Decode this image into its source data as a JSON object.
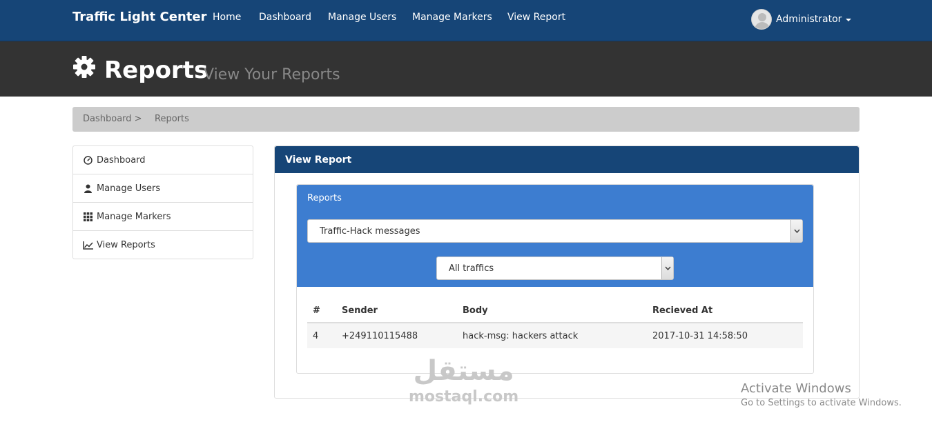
{
  "navbar": {
    "brand": "Traffic Light Center",
    "links": [
      "Home",
      "Dashboard",
      "Manage Users",
      "Manage Markers",
      "View Report"
    ],
    "user": "Administrator"
  },
  "header": {
    "title": "Reports",
    "subtitle": "View Your Reports"
  },
  "breadcrumb": {
    "items": [
      "Dashboard >",
      "Reports"
    ]
  },
  "sidebar": {
    "items": [
      {
        "label": "Dashboard",
        "icon": "dashboard-icon"
      },
      {
        "label": "Manage Users",
        "icon": "user-icon"
      },
      {
        "label": "Manage Markers",
        "icon": "grid-icon"
      },
      {
        "label": "View Reports",
        "icon": "line-chart-icon"
      }
    ]
  },
  "panel": {
    "heading": "View Report",
    "inner_label": "Reports",
    "report_select": "Traffic-Hack messages",
    "traffic_select": "All traffics",
    "table": {
      "headers": [
        "#",
        "Sender",
        "Body",
        "Recieved At"
      ],
      "rows": [
        [
          "4",
          "+249110115488",
          "hack-msg: hackers attack",
          "2017-10-31 14:58:50"
        ]
      ]
    }
  },
  "watermark": {
    "arabic": "مستقل",
    "latin": "mostaql.com"
  },
  "windows_notice": {
    "title": "Activate Windows",
    "subtitle": "Go to Settings to activate Windows."
  },
  "colors": {
    "navbar": "#164577",
    "header": "#333333",
    "inner_accent": "#3d7dd0",
    "breadcrumb": "#cccccc"
  }
}
